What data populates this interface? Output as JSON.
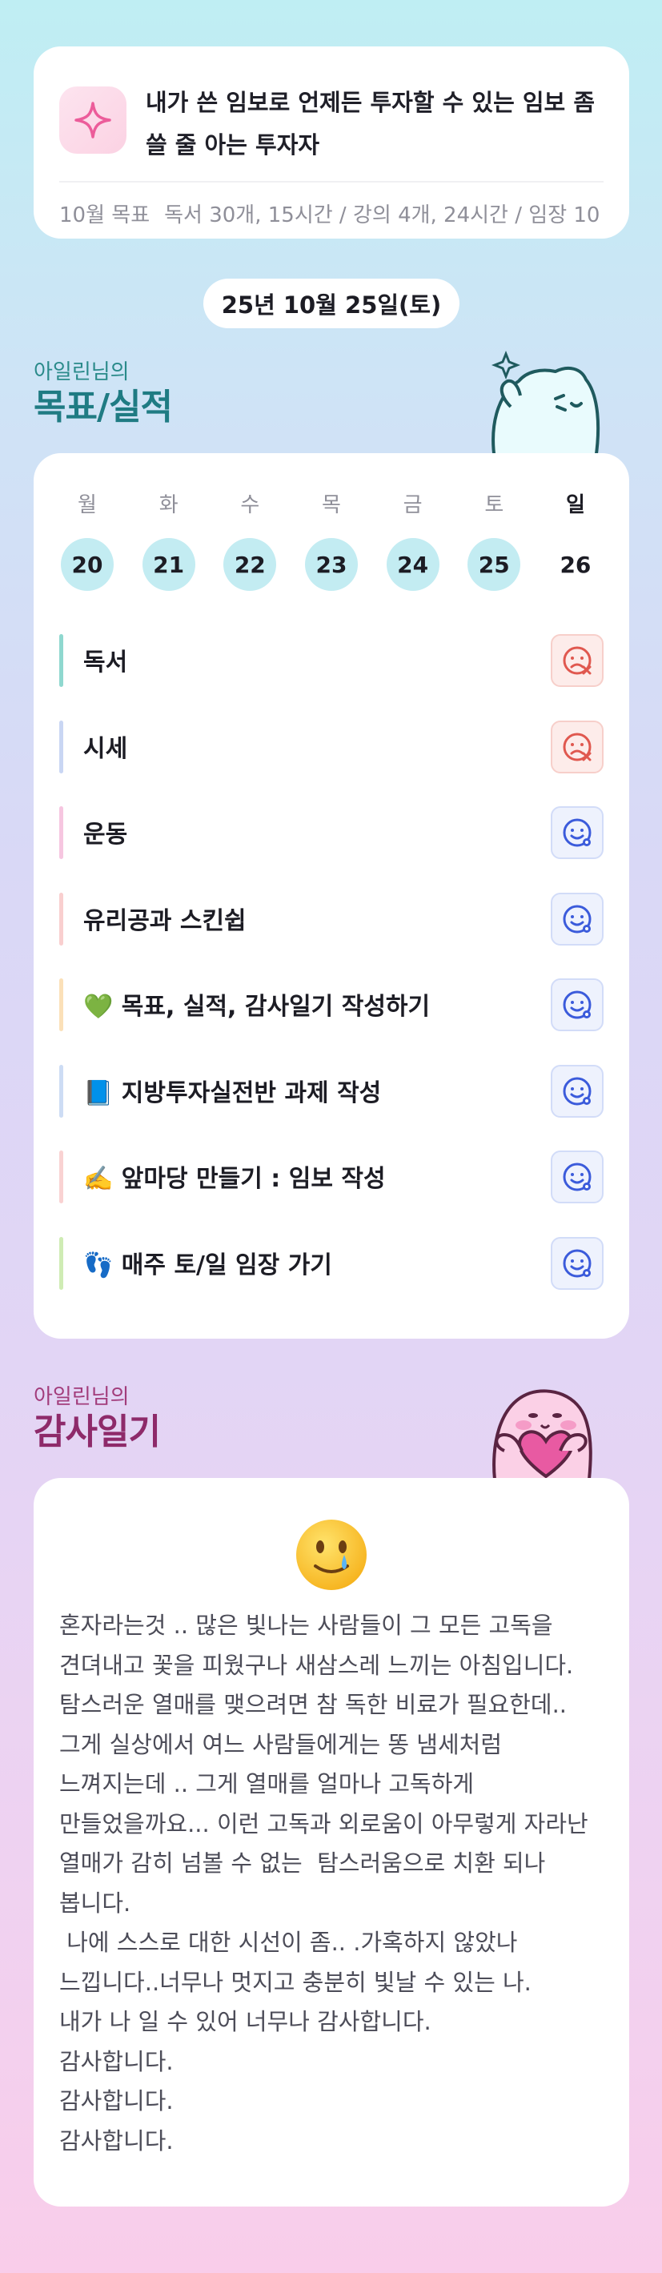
{
  "goal": {
    "title": "내가 쓴 임보로 언제든 투자할 수 있는 임보 좀 쓸 줄 아는 투자자",
    "target_label": "10월 목표",
    "target_value": "독서 30개, 15시간 / 강의 4개, 24시간 / 임장 10",
    "icon": "sparkle-icon"
  },
  "date": "25년 10월 25일(토)",
  "goals_section": {
    "subtitle": "아일린님의",
    "title": "목표/실적"
  },
  "week": {
    "days": [
      {
        "label": "월",
        "date": "20",
        "done": true
      },
      {
        "label": "화",
        "date": "21",
        "done": true
      },
      {
        "label": "수",
        "date": "22",
        "done": true
      },
      {
        "label": "목",
        "date": "23",
        "done": true
      },
      {
        "label": "금",
        "date": "24",
        "done": true
      },
      {
        "label": "토",
        "date": "25",
        "done": true
      },
      {
        "label": "일",
        "date": "26",
        "done": false
      }
    ]
  },
  "tasks": [
    {
      "label": "독서",
      "status": "fail",
      "color": "#8fd8cf"
    },
    {
      "label": "시세",
      "status": "fail",
      "color": "#c9d6f3"
    },
    {
      "label": "운동",
      "status": "done",
      "color": "#f6c6e0"
    },
    {
      "label": "유리공과 스킨쉽",
      "status": "done",
      "color": "#f9cfcf"
    },
    {
      "label": "💚 목표, 실적, 감사일기 작성하기",
      "status": "done",
      "color": "#fbe0b8"
    },
    {
      "label": "📘 지방투자실전반 과제 작성",
      "status": "done",
      "color": "#cddcf4"
    },
    {
      "label": "✍️ 앞마당 만들기 : 임보 작성",
      "status": "done",
      "color": "#f9d2d2"
    },
    {
      "label": "👣 매주 토/일 임장 가기",
      "status": "done",
      "color": "#cfecb4"
    }
  ],
  "diary_section": {
    "subtitle": "아일린님의",
    "title": "감사일기"
  },
  "diary": {
    "emoji": "🥲",
    "text": "혼자라는것 .. 많은 빛나는 사람들이 그 모든 고독을 견뎌내고 꽃을 피웠구나 새삼스레 느끼는 아침입니다.\n탐스러운 열매를 맺으려면 참 독한 비료가 필요한데.. 그게 실상에서 여느 사람들에게는 똥 냄세처럼 느껴지는데 .. 그게 열매를 얼마나 고독하게 만들었을까요... 이런 고독과 외로움이 아무렇게 자라난 열매가 감히 넘볼 수 없는  탐스러움으로 치환 되나 봅니다.\n 나에 스스로 대한 시선이 좀.. .가혹하지 않았나 느낍니다..너무나 멋지고 충분히 빛날 수 있는 나.\n내가 나 일 수 있어 너무나 감사합니다.\n감사합니다.\n감사합니다.\n감사합니다."
  },
  "colors": {
    "accent_teal": "#1f7b83",
    "accent_pink": "#8e2a6a",
    "fail_red": "#e0584f",
    "ok_blue": "#3b5bdb",
    "day_done_bg": "#c3ecf2"
  }
}
